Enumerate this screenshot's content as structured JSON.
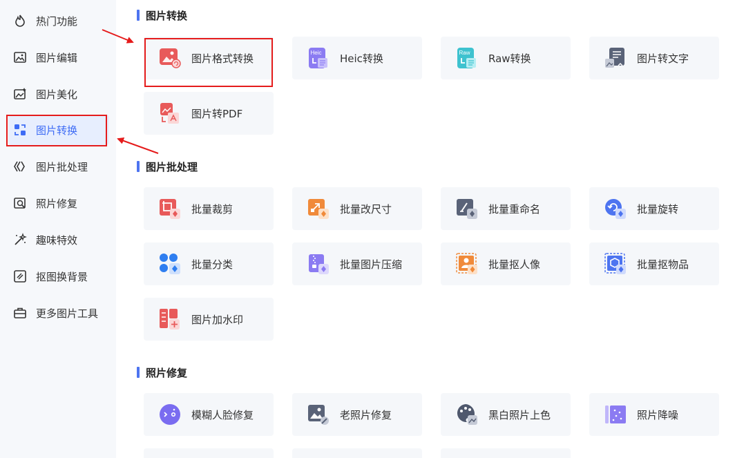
{
  "sidebar": {
    "items": [
      {
        "label": "热门功能",
        "icon": "flame-icon"
      },
      {
        "label": "图片编辑",
        "icon": "image-edit-icon"
      },
      {
        "label": "图片美化",
        "icon": "image-beautify-icon"
      },
      {
        "label": "图片转换",
        "icon": "image-convert-icon",
        "active": true
      },
      {
        "label": "图片批处理",
        "icon": "batch-icon"
      },
      {
        "label": "照片修复",
        "icon": "photo-repair-icon"
      },
      {
        "label": "趣味特效",
        "icon": "magic-wand-icon"
      },
      {
        "label": "抠图换背景",
        "icon": "cutout-icon"
      },
      {
        "label": "更多图片工具",
        "icon": "toolbox-icon"
      }
    ]
  },
  "sections": {
    "convert": {
      "title": "图片转换",
      "cards": [
        {
          "label": "图片格式转换",
          "icon": "image-format-icon"
        },
        {
          "label": "Heic转换",
          "icon": "heic-icon",
          "badge": "Heic"
        },
        {
          "label": "Raw转换",
          "icon": "raw-icon",
          "badge": "Raw"
        },
        {
          "label": "图片转文字",
          "icon": "image-to-text-icon"
        },
        {
          "label": "图片转PDF",
          "icon": "image-to-pdf-icon"
        }
      ]
    },
    "batch": {
      "title": "图片批处理",
      "cards": [
        {
          "label": "批量裁剪",
          "icon": "crop-icon"
        },
        {
          "label": "批量改尺寸",
          "icon": "resize-icon"
        },
        {
          "label": "批量重命名",
          "icon": "rename-icon"
        },
        {
          "label": "批量旋转",
          "icon": "rotate-icon"
        },
        {
          "label": "批量分类",
          "icon": "classify-icon"
        },
        {
          "label": "批量图片压缩",
          "icon": "compress-icon"
        },
        {
          "label": "批量抠人像",
          "icon": "portrait-cutout-icon"
        },
        {
          "label": "批量抠物品",
          "icon": "object-cutout-icon"
        },
        {
          "label": "图片加水印",
          "icon": "watermark-icon"
        }
      ]
    },
    "repair": {
      "title": "照片修复",
      "cards": [
        {
          "label": "模糊人脸修复",
          "icon": "face-repair-icon"
        },
        {
          "label": "老照片修复",
          "icon": "old-photo-icon"
        },
        {
          "label": "黑白照片上色",
          "icon": "colorize-icon"
        },
        {
          "label": "照片降噪",
          "icon": "denoise-icon"
        }
      ]
    }
  },
  "colors": {
    "accent": "#3d6bf5",
    "highlight_box": "#e51b1b"
  }
}
